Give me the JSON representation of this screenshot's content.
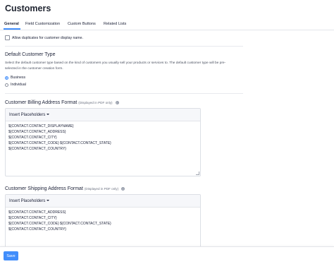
{
  "page": {
    "title": "Customers"
  },
  "tabs": [
    {
      "label": "General",
      "active": true
    },
    {
      "label": "Field Customization",
      "active": false
    },
    {
      "label": "Custom Buttons",
      "active": false
    },
    {
      "label": "Related Lists",
      "active": false
    }
  ],
  "duplicates": {
    "label": "Allow duplicates for customer display name.",
    "checked": false
  },
  "customer_type": {
    "title": "Default Customer Type",
    "description": "Select the default customer type based on the kind of customers you usually sell your products or services to. The default customer type will be pre-selected in the customer creation form.",
    "options": [
      {
        "label": "Business",
        "selected": true
      },
      {
        "label": "Individual",
        "selected": false
      }
    ]
  },
  "billing": {
    "title": "Customer Billing Address Format",
    "note": "(Displayed in PDF only)",
    "insert_label": "Insert Placeholders",
    "lines": [
      "${CONTACT.CONTACT_DISPLAYNAME}",
      "${CONTACT.CONTACT_ADDRESS}",
      "${CONTACT.CONTACT_CITY}",
      "${CONTACT.CONTACT_CODE} ${CONTACT.CONTACT_STATE}",
      "${CONTACT.CONTACT_COUNTRY}"
    ]
  },
  "shipping": {
    "title": "Customer Shipping Address Format",
    "note": "(Displayed in PDF only)",
    "insert_label": "Insert Placeholders",
    "lines": [
      "${CONTACT.CONTACT_ADDRESS}",
      "${CONTACT.CONTACT_CITY}",
      "${CONTACT.CONTACT_CODE} ${CONTACT.CONTACT_STATE}",
      "${CONTACT.CONTACT_COUNTRY}"
    ]
  },
  "footer": {
    "save_label": "Save"
  },
  "colors": {
    "accent": "#408dfb",
    "text": "#21263c"
  },
  "icons": {
    "info": "info-icon",
    "dropdown": "caret-down-icon"
  }
}
